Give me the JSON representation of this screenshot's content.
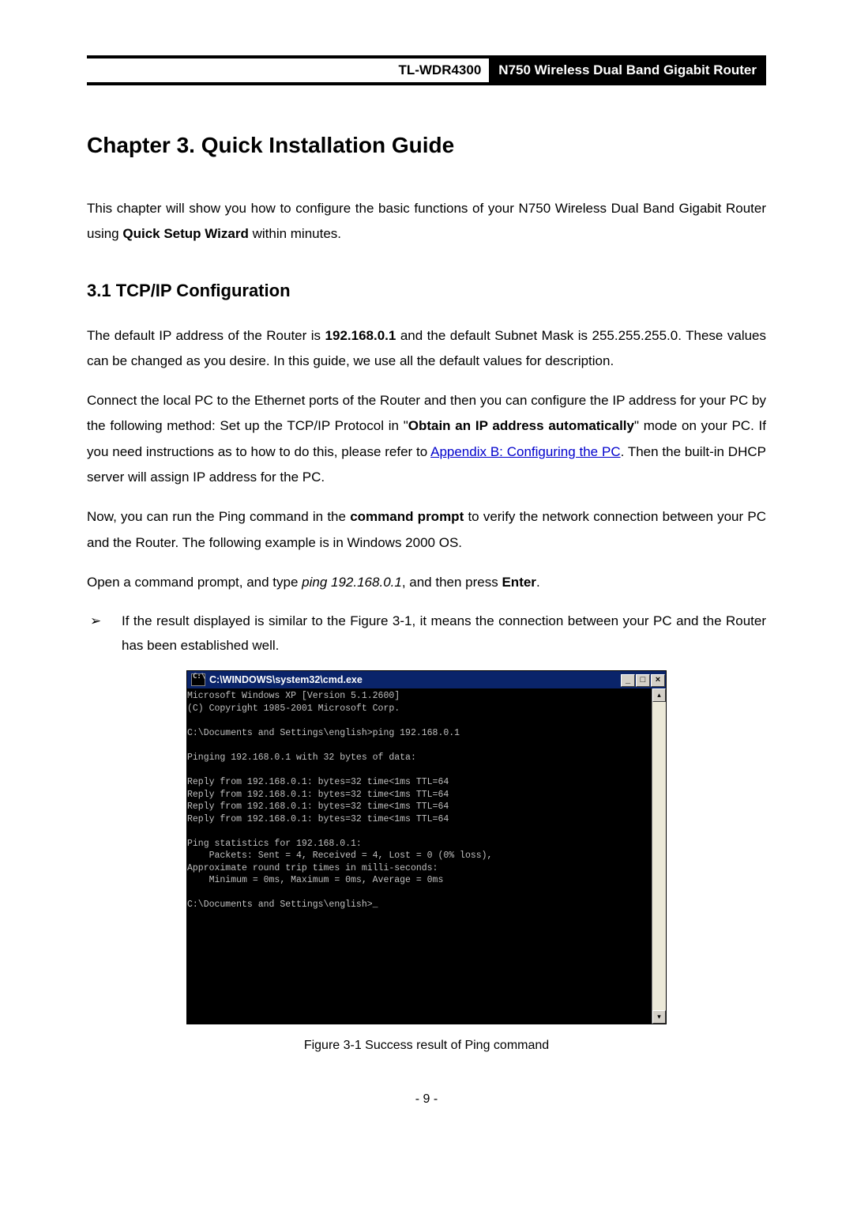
{
  "header": {
    "model": "TL-WDR4300",
    "desc": "N750 Wireless Dual Band Gigabit Router"
  },
  "chapter_title": "Chapter 3.   Quick Installation Guide",
  "section_title": "3.1     TCP/IP Configuration",
  "intro_1a": "This chapter will show you how to configure the basic functions of your  N750 Wireless Dual Band Gigabit Router using ",
  "intro_1b": "Quick Setup Wizard",
  "intro_1c": " within minutes.",
  "p2a": "The default IP address of the Router is ",
  "p2b": "192.168.0.1",
  "p2c": " and the default Subnet Mask is 255.255.255.0. These values can be changed as you desire. In this guide, we use all the default values for description.",
  "p3a": "Connect the local PC to the Ethernet ports of the Router and then you can configure the IP address for your PC by the following method: Set up the TCP/IP Protocol in \"",
  "p3b": "Obtain an IP address automatically",
  "p3c": "\" mode on your PC. If you need instructions as to how to do this, please refer to ",
  "p3link": "Appendix B: Configuring the PC",
  "p3d": ". Then the built-in DHCP server will assign IP address for the PC.",
  "p4a": "Now, you can run the Ping command in the ",
  "p4b": "command prompt",
  "p4c": " to verify the network connection between your PC and the Router. The following example is in Windows 2000 OS.",
  "p5a": "Open a command prompt, and type ",
  "p5b": "ping 192.168.0.1",
  "p5c": ", and then press ",
  "p5d": "Enter",
  "p5e": ".",
  "bullet_text": "If the result displayed is similar to the Figure 3-1, it means the connection between your PC and the Router has been established well.",
  "cmd": {
    "title": "C:\\WINDOWS\\system32\\cmd.exe",
    "icon_text": "C:\\",
    "min": "_",
    "max": "□",
    "close": "×",
    "up": "▴",
    "down": "▾",
    "body": "Microsoft Windows XP [Version 5.1.2600]\n(C) Copyright 1985-2001 Microsoft Corp.\n\nC:\\Documents and Settings\\english>ping 192.168.0.1\n\nPinging 192.168.0.1 with 32 bytes of data:\n\nReply from 192.168.0.1: bytes=32 time<1ms TTL=64\nReply from 192.168.0.1: bytes=32 time<1ms TTL=64\nReply from 192.168.0.1: bytes=32 time<1ms TTL=64\nReply from 192.168.0.1: bytes=32 time<1ms TTL=64\n\nPing statistics for 192.168.0.1:\n    Packets: Sent = 4, Received = 4, Lost = 0 (0% loss),\nApproximate round trip times in milli-seconds:\n    Minimum = 0ms, Maximum = 0ms, Average = 0ms\n\nC:\\Documents and Settings\\english>_\n\n\n\n\n\n"
  },
  "fig_caption": "Figure 3-1 Success result of Ping command",
  "page_num": "- 9 -"
}
